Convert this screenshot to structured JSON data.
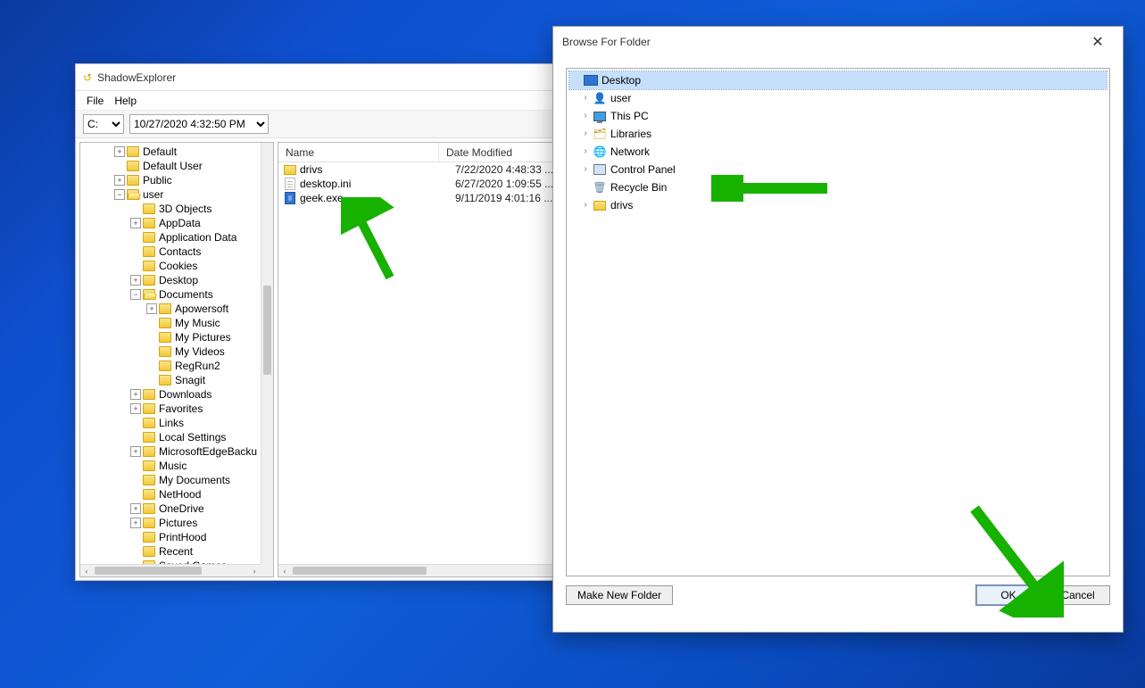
{
  "shadow": {
    "title": "ShadowExplorer",
    "menu": {
      "file": "File",
      "help": "Help"
    },
    "drive": "C:",
    "snapshot": "10/27/2020 4:32:50 PM",
    "tree": {
      "top": [
        {
          "label": "Default",
          "tw": "+"
        },
        {
          "label": "Default User",
          "tw": ""
        },
        {
          "label": "Public",
          "tw": "+"
        },
        {
          "label": "user",
          "tw": "-"
        }
      ],
      "user": [
        {
          "label": "3D Objects",
          "tw": ""
        },
        {
          "label": "AppData",
          "tw": "+"
        },
        {
          "label": "Application Data",
          "tw": ""
        },
        {
          "label": "Contacts",
          "tw": ""
        },
        {
          "label": "Cookies",
          "tw": ""
        },
        {
          "label": "Desktop",
          "tw": "+"
        },
        {
          "label": "Documents",
          "tw": "-"
        }
      ],
      "documents": [
        {
          "label": "Apowersoft",
          "tw": "+"
        },
        {
          "label": "My Music",
          "tw": ""
        },
        {
          "label": "My Pictures",
          "tw": ""
        },
        {
          "label": "My Videos",
          "tw": ""
        },
        {
          "label": "RegRun2",
          "tw": ""
        },
        {
          "label": "Snagit",
          "tw": ""
        }
      ],
      "user2": [
        {
          "label": "Downloads",
          "tw": "+"
        },
        {
          "label": "Favorites",
          "tw": "+"
        },
        {
          "label": "Links",
          "tw": ""
        },
        {
          "label": "Local Settings",
          "tw": ""
        },
        {
          "label": "MicrosoftEdgeBacku",
          "tw": "+"
        },
        {
          "label": "Music",
          "tw": ""
        },
        {
          "label": "My Documents",
          "tw": ""
        },
        {
          "label": "NetHood",
          "tw": ""
        },
        {
          "label": "OneDrive",
          "tw": "+"
        },
        {
          "label": "Pictures",
          "tw": "+"
        },
        {
          "label": "PrintHood",
          "tw": ""
        },
        {
          "label": "Recent",
          "tw": ""
        },
        {
          "label": "Saved Games",
          "tw": ""
        }
      ]
    },
    "list": {
      "cols": {
        "name": "Name",
        "date": "Date Modified"
      },
      "rows": [
        {
          "icon": "folder",
          "name": "drivs",
          "date": "7/22/2020 4:48:33 ..."
        },
        {
          "icon": "ini",
          "name": "desktop.ini",
          "date": "6/27/2020 1:09:55 ..."
        },
        {
          "icon": "exe",
          "name": "geek.exe",
          "date": "9/11/2019 4:01:16 ..."
        }
      ]
    }
  },
  "dialog": {
    "title": "Browse For Folder",
    "close": "✕",
    "items": [
      {
        "label": "Desktop",
        "chev": "",
        "icon": "desktop",
        "selected": true
      },
      {
        "label": "user",
        "chev": "›",
        "icon": "user"
      },
      {
        "label": "This PC",
        "chev": "›",
        "icon": "thispc"
      },
      {
        "label": "Libraries",
        "chev": "›",
        "icon": "lib"
      },
      {
        "label": "Network",
        "chev": "›",
        "icon": "net"
      },
      {
        "label": "Control Panel",
        "chev": "›",
        "icon": "cp"
      },
      {
        "label": "Recycle Bin",
        "chev": "",
        "icon": "bin"
      },
      {
        "label": "drivs",
        "chev": "›",
        "icon": "folder"
      }
    ],
    "buttons": {
      "new": "Make New Folder",
      "ok": "OK",
      "cancel": "Cancel"
    }
  }
}
